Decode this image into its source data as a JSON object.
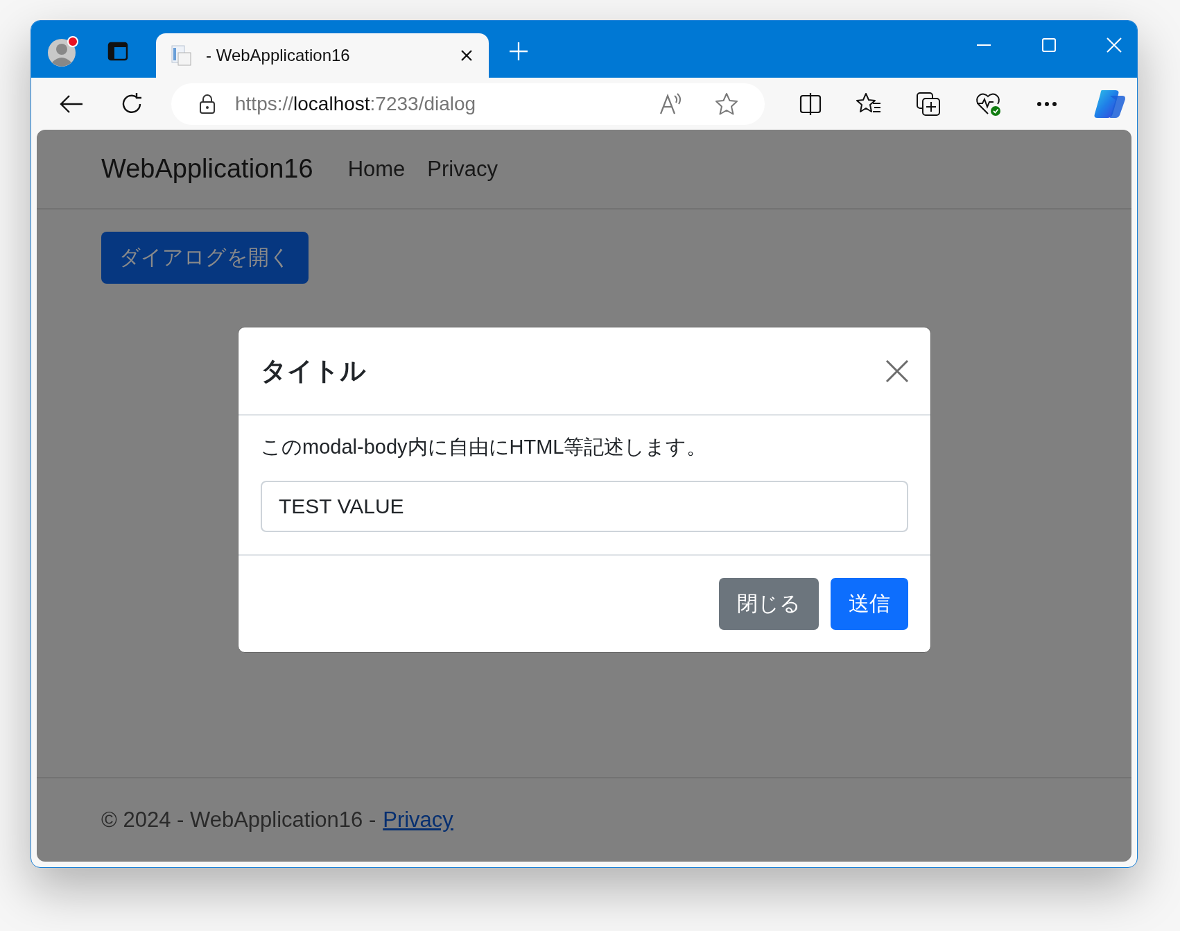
{
  "browser": {
    "tab": {
      "title": "- WebApplication16",
      "selected": true
    },
    "address": {
      "scheme": "https://",
      "host": "localhost",
      "rest": ":7233/dialog"
    }
  },
  "navbar": {
    "brand": "WebApplication16",
    "links": [
      "Home",
      "Privacy"
    ]
  },
  "open_button": "ダイアログを開く",
  "modal": {
    "title": "タイトル",
    "body_text": "このmodal-body内に自由にHTML等記述します。",
    "input_value": "TEST VALUE",
    "buttons": [
      {
        "label": "閉じる",
        "kind": "secondary"
      },
      {
        "label": "送信",
        "kind": "primary"
      }
    ]
  },
  "footer": {
    "text": "© 2024 - WebApplication16 -",
    "link": "Privacy"
  }
}
